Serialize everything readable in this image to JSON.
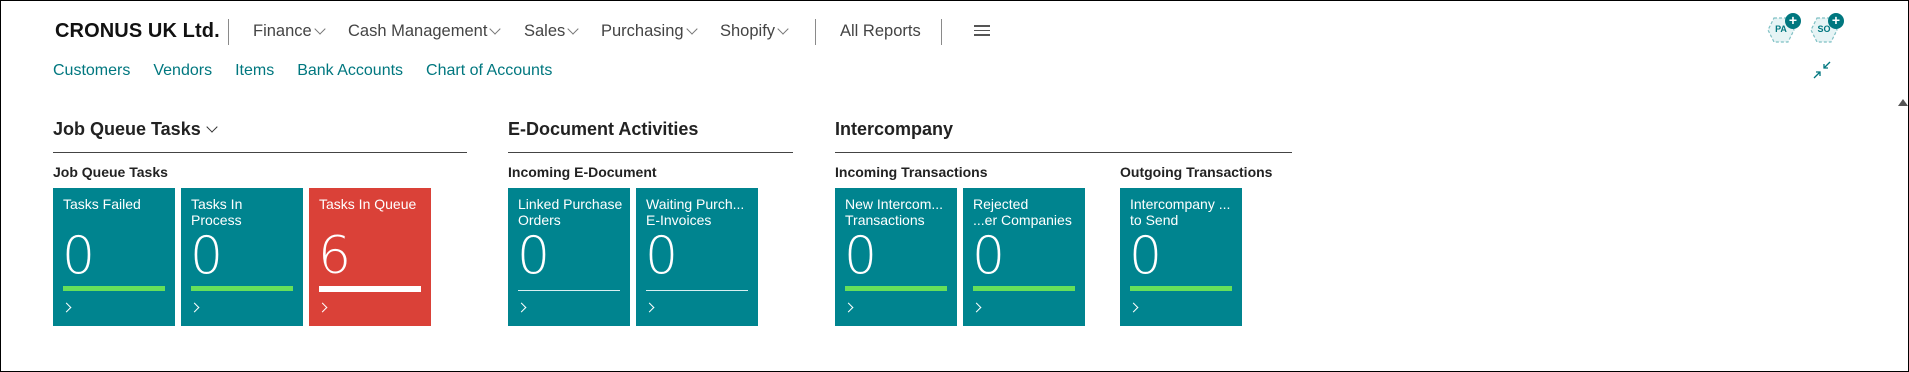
{
  "company": "CRONUS UK Ltd.",
  "menus": [
    {
      "label": "Finance"
    },
    {
      "label": "Cash Management"
    },
    {
      "label": "Sales"
    },
    {
      "label": "Purchasing"
    },
    {
      "label": "Shopify"
    }
  ],
  "all_reports": "All Reports",
  "avatars": [
    {
      "initials": "PA"
    },
    {
      "initials": "SO"
    }
  ],
  "nav_links": [
    "Customers",
    "Vendors",
    "Items",
    "Bank Accounts",
    "Chart of Accounts"
  ],
  "groups": {
    "job_queue": {
      "title": "Job Queue Tasks",
      "subtitle": "Job Queue Tasks",
      "tiles": [
        {
          "label": "Tasks Failed",
          "value": "0",
          "bar": "green"
        },
        {
          "label": "Tasks In\nProcess",
          "value": "0",
          "bar": "green"
        },
        {
          "label": "Tasks In Queue",
          "value": "6",
          "bar": "white",
          "status_color": "#da4138"
        }
      ]
    },
    "edocument": {
      "title": "E-Document Activities",
      "subtitle": "Incoming E-Document",
      "tiles": [
        {
          "label": "Linked Purchase\nOrders",
          "value": "0",
          "bar": "thin"
        },
        {
          "label": "Waiting Purch...\nE-Invoices",
          "value": "0",
          "bar": "thin"
        }
      ]
    },
    "intercompany": {
      "title": "Intercompany",
      "incoming_subtitle": "Incoming Transactions",
      "outgoing_subtitle": "Outgoing Transactions",
      "incoming_tiles": [
        {
          "label": "New Intercom...\nTransactions",
          "value": "0",
          "bar": "green"
        },
        {
          "label": "Rejected\n...er Companies",
          "value": "0",
          "bar": "green"
        }
      ],
      "outgoing_tiles": [
        {
          "label": "Intercompany ...\nto Send",
          "value": "0",
          "bar": "green"
        }
      ]
    }
  },
  "colors": {
    "accent": "#00777f",
    "tile": "#00848f",
    "alert": "#da4138",
    "good": "#66e05a"
  }
}
